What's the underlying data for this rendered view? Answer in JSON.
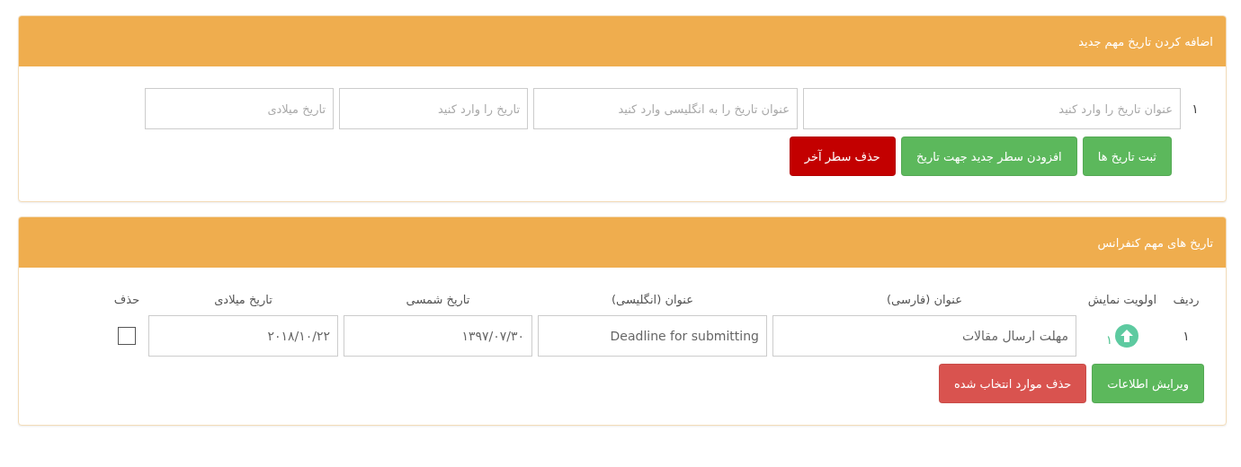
{
  "add_panel": {
    "title": "اضافه کردن تاریخ مهم جدید",
    "rows": [
      {
        "number": "۱",
        "fields": [
          {
            "placeholder": "عنوان تاریخ را وارد کنید"
          },
          {
            "placeholder": "عنوان تاریخ را به انگلیسی وارد کنید"
          },
          {
            "placeholder": "تاریخ را وارد کنید"
          },
          {
            "placeholder": "تاریخ میلادی"
          }
        ]
      }
    ],
    "buttons": [
      {
        "label": "ثبت تاریخ ها",
        "kind": "success"
      },
      {
        "label": "افزودن سطر جدید جهت تاریخ",
        "kind": "success"
      },
      {
        "label": "حذف سطر آخر",
        "kind": "darkdanger"
      }
    ]
  },
  "dates_panel": {
    "title": "تاریخ های مهم کنفرانس",
    "table": {
      "columns": [
        "ردیف",
        "اولویت نمایش",
        "عنوان (فارسی)",
        "عنوان (انگلیسی)",
        "تاریخ شمسی",
        "تاریخ میلادی",
        "حذف"
      ],
      "rows": [
        {
          "number": "۱",
          "priority": "۱",
          "title_fa": "مهلت ارسال مقالات",
          "title_en": "Deadline for submitting",
          "date_shamsi": "۱۳۹۷/۰۷/۳۰",
          "date_miladi": "۲۰۱۸/۱۰/۲۲",
          "checked": false
        }
      ]
    },
    "buttons": [
      {
        "label": "ویرایش اطلاعات",
        "kind": "success"
      },
      {
        "label": "حذف موارد انتخاب شده",
        "kind": "danger"
      }
    ]
  }
}
